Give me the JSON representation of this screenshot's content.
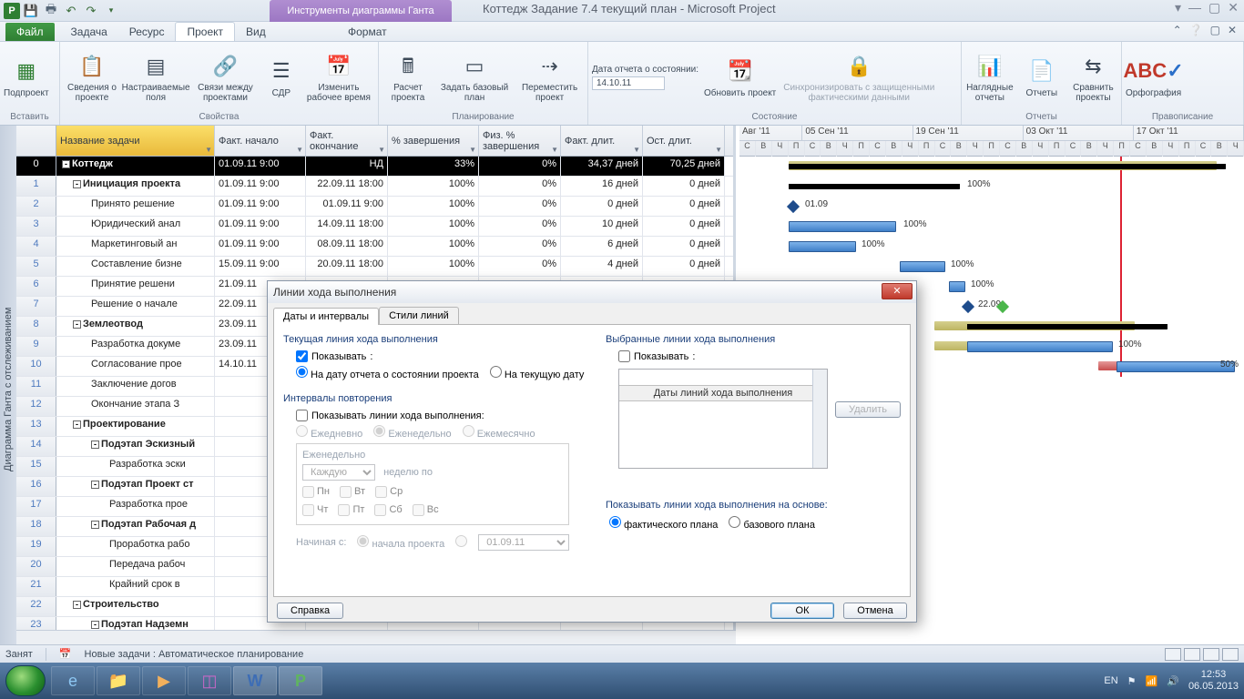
{
  "title": "Коттедж Задание 7.4 текущий план  -  Microsoft Project",
  "contextual_tab": "Инструменты диаграммы Ганта",
  "tabs": {
    "file": "Файл",
    "task": "Задача",
    "resource": "Ресурс",
    "project": "Проект",
    "view": "Вид",
    "format": "Формат"
  },
  "ribbon": {
    "insert": {
      "label": "Вставить",
      "subproject": "Подпроект"
    },
    "props": {
      "label": "Свойства",
      "info": "Сведения о проекте",
      "custom": "Настраиваемые поля",
      "links": "Связи между проектами",
      "wbs": "СДР",
      "worktime": "Изменить рабочее время"
    },
    "plan": {
      "label": "Планирование",
      "calc": "Расчет проекта",
      "baseline": "Задать базовый план",
      "move": "Переместить проект"
    },
    "status": {
      "label": "Состояние",
      "datelabel": "Дата отчета о состоянии:",
      "date": "14.10.11",
      "update": "Обновить проект",
      "sync": "Синхронизировать с защищенными фактическими данными"
    },
    "reports": {
      "label": "Отчеты",
      "visual": "Наглядные отчеты",
      "reports": "Отчеты",
      "compare": "Сравнить проекты"
    },
    "spell": {
      "label": "Правописание",
      "btn": "Орфография"
    }
  },
  "sidebar": "Диаграмма Ганта с отслеживанием",
  "columns": {
    "name": "Название задачи",
    "fstart": "Факт. начало",
    "fend": "Факт. окончание",
    "pct": "% завершения",
    "phys": "Физ. % завершения",
    "fdur": "Факт. длит.",
    "rdur": "Ост. длит."
  },
  "rows": [
    {
      "n": 0,
      "name": "Коттедж",
      "ind": 0,
      "out": "-",
      "fs": "01.09.11 9:00",
      "fe": "НД",
      "pc": "33%",
      "ph": "0%",
      "fd": "34,37 дней",
      "rd": "70,25 дней"
    },
    {
      "n": 1,
      "name": "Инициация проекта",
      "ind": 1,
      "out": "-",
      "fs": "01.09.11 9:00",
      "fe": "22.09.11 18:00",
      "pc": "100%",
      "ph": "0%",
      "fd": "16 дней",
      "rd": "0 дней"
    },
    {
      "n": 2,
      "name": "Принято решение",
      "ind": 2,
      "fs": "01.09.11 9:00",
      "fe": "01.09.11 9:00",
      "pc": "100%",
      "ph": "0%",
      "fd": "0 дней",
      "rd": "0 дней"
    },
    {
      "n": 3,
      "name": "Юридический анал",
      "ind": 2,
      "fs": "01.09.11 9:00",
      "fe": "14.09.11 18:00",
      "pc": "100%",
      "ph": "0%",
      "fd": "10 дней",
      "rd": "0 дней"
    },
    {
      "n": 4,
      "name": "Маркетинговый ан",
      "ind": 2,
      "fs": "01.09.11 9:00",
      "fe": "08.09.11 18:00",
      "pc": "100%",
      "ph": "0%",
      "fd": "6 дней",
      "rd": "0 дней"
    },
    {
      "n": 5,
      "name": "Составление бизне",
      "ind": 2,
      "fs": "15.09.11 9:00",
      "fe": "20.09.11 18:00",
      "pc": "100%",
      "ph": "0%",
      "fd": "4 дней",
      "rd": "0 дней"
    },
    {
      "n": 6,
      "name": "Принятие решени",
      "ind": 2,
      "fs": "21.09.11",
      "fe": "",
      "pc": "",
      "ph": "",
      "fd": "",
      "rd": ""
    },
    {
      "n": 7,
      "name": "Решение о начале",
      "ind": 2,
      "fs": "22.09.11",
      "fe": "",
      "pc": "",
      "ph": "",
      "fd": "",
      "rd": ""
    },
    {
      "n": 8,
      "name": "Землеотвод",
      "ind": 1,
      "out": "-",
      "fs": "23.09.11",
      "fe": "",
      "pc": "",
      "ph": "",
      "fd": "",
      "rd": ""
    },
    {
      "n": 9,
      "name": "Разработка докуме",
      "ind": 2,
      "fs": "23.09.11",
      "fe": "",
      "pc": "",
      "ph": "",
      "fd": "",
      "rd": ""
    },
    {
      "n": 10,
      "name": "Согласование прое",
      "ind": 2,
      "fs": "14.10.11",
      "fe": "",
      "pc": "",
      "ph": "",
      "fd": "",
      "rd": ""
    },
    {
      "n": 11,
      "name": "Заключение догов",
      "ind": 2,
      "fs": "",
      "fe": "",
      "pc": "",
      "ph": "",
      "fd": "",
      "rd": ""
    },
    {
      "n": 12,
      "name": "Окончание этапа З",
      "ind": 2,
      "fs": "",
      "fe": "",
      "pc": "",
      "ph": "",
      "fd": "",
      "rd": ""
    },
    {
      "n": 13,
      "name": "Проектирование",
      "ind": 1,
      "out": "-",
      "fs": "",
      "fe": "",
      "pc": "",
      "ph": "",
      "fd": "",
      "rd": ""
    },
    {
      "n": 14,
      "name": "Подэтап Эскизный",
      "ind": "2b",
      "out": "-",
      "fs": "",
      "fe": "",
      "pc": "",
      "ph": "",
      "fd": "",
      "rd": ""
    },
    {
      "n": 15,
      "name": "Разработка эски",
      "ind": 3,
      "fs": "",
      "fe": "",
      "pc": "",
      "ph": "",
      "fd": "",
      "rd": ""
    },
    {
      "n": 16,
      "name": "Подэтап Проект ст",
      "ind": "2b",
      "out": "-",
      "fs": "",
      "fe": "",
      "pc": "",
      "ph": "",
      "fd": "",
      "rd": ""
    },
    {
      "n": 17,
      "name": "Разработка прое",
      "ind": 3,
      "fs": "",
      "fe": "",
      "pc": "",
      "ph": "",
      "fd": "",
      "rd": ""
    },
    {
      "n": 18,
      "name": "Подэтап Рабочая д",
      "ind": "2b",
      "out": "-",
      "fs": "",
      "fe": "",
      "pc": "",
      "ph": "",
      "fd": "",
      "rd": ""
    },
    {
      "n": 19,
      "name": "Проработка рабо",
      "ind": 3,
      "fs": "",
      "fe": "",
      "pc": "",
      "ph": "",
      "fd": "",
      "rd": ""
    },
    {
      "n": 20,
      "name": "Передача рабоч",
      "ind": 3,
      "fs": "",
      "fe": "",
      "pc": "",
      "ph": "",
      "fd": "",
      "rd": ""
    },
    {
      "n": 21,
      "name": "Крайний срок в",
      "ind": 3,
      "fs": "",
      "fe": "",
      "pc": "",
      "ph": "",
      "fd": "",
      "rd": ""
    },
    {
      "n": 22,
      "name": "Строительство",
      "ind": 1,
      "out": "-",
      "fs": "",
      "fe": "",
      "pc": "",
      "ph": "",
      "fd": "",
      "rd": ""
    },
    {
      "n": 23,
      "name": "Подэтап Надземн",
      "ind": "2b",
      "out": "-",
      "fs": "",
      "fe": "",
      "pc": "",
      "ph": "",
      "fd": "",
      "rd": ""
    }
  ],
  "timeline": {
    "sections": [
      "Авг '11",
      "05 Сен '11",
      "19 Сен '11",
      "03 Окт '11",
      "17 Окт '11"
    ],
    "days": [
      "С",
      "В",
      "Ч",
      "П",
      "С",
      "В",
      "Ч",
      "П",
      "С",
      "В",
      "Ч",
      "П",
      "С",
      "В",
      "Ч",
      "П",
      "С",
      "В",
      "Ч",
      "П",
      "С",
      "В",
      "Ч",
      "П",
      "С",
      "В",
      "Ч",
      "П",
      "С",
      "В",
      "Ч"
    ]
  },
  "gantt_labels": {
    "l100": "100%",
    "l50": "50%",
    "d0109": "01.09",
    "d2209": "22.09"
  },
  "dialog": {
    "title": "Линии хода выполнения",
    "tab1": "Даты и интервалы",
    "tab2": "Стили линий",
    "sect_current": "Текущая линия хода выполнения",
    "show": "Показывать",
    "opt_report": "На дату отчета о состоянии проекта",
    "opt_today": "На текущую дату",
    "sect_repeat": "Интервалы повторения",
    "show_lines": "Показывать линии хода выполнения:",
    "daily": "Ежедневно",
    "weekly": "Еженедельно",
    "monthly": "Ежемесячно",
    "weekly_box": "Еженедельно",
    "every": "Каждую",
    "week_on": "неделю по",
    "mon": "Пн",
    "tue": "Вт",
    "wed": "Ср",
    "thu": "Чт",
    "fri": "Пт",
    "sat": "Сб",
    "sun": "Вс",
    "start_from": "Начиная с:",
    "proj_start": "начала проекта",
    "date": "01.09.11",
    "sect_selected": "Выбранные линии хода выполнения",
    "list_head": "Даты линий хода выполнения",
    "delete": "Удалить",
    "sect_basis": "Показывать линии хода выполнения на основе:",
    "actual": "фактического плана",
    "baseline": "базового плана",
    "help": "Справка",
    "ok": "ОК",
    "cancel": "Отмена"
  },
  "statusbar": {
    "busy": "Занят",
    "newtasks": "Новые задачи : Автоматическое планирование"
  },
  "tray": {
    "lang": "EN",
    "time": "12:53",
    "date": "06.05.2013"
  }
}
